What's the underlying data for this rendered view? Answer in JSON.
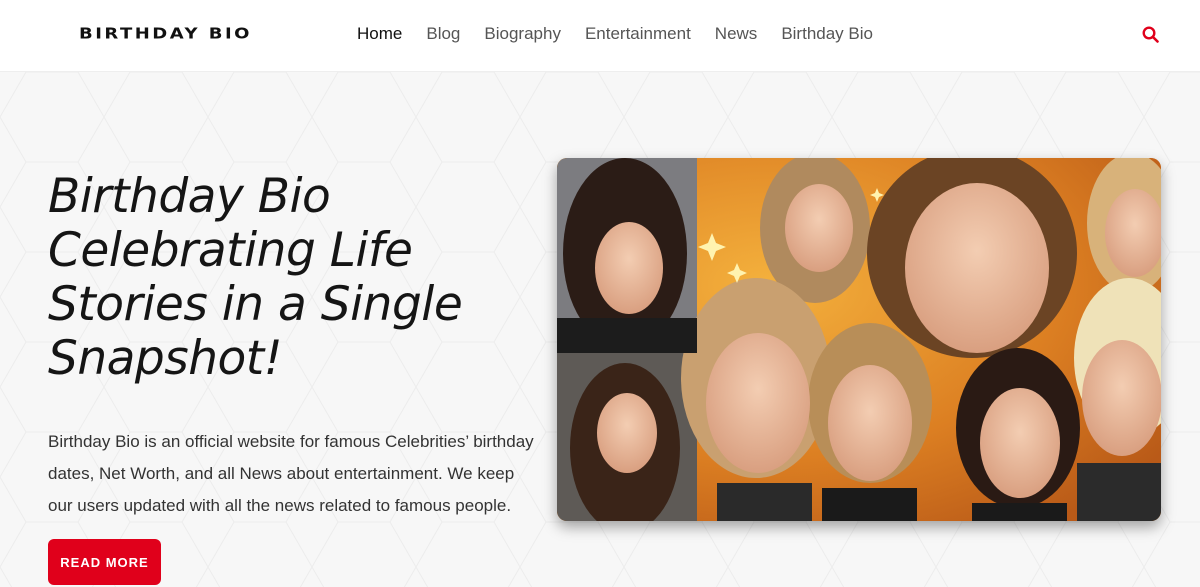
{
  "header": {
    "logo_text": "BIRTHDAY BIO",
    "nav": [
      {
        "label": "Home",
        "active": true
      },
      {
        "label": "Blog",
        "active": false
      },
      {
        "label": "Biography",
        "active": false
      },
      {
        "label": "Entertainment",
        "active": false
      },
      {
        "label": "News",
        "active": false
      },
      {
        "label": "Birthday Bio",
        "active": false
      }
    ],
    "search_icon": "search-icon"
  },
  "hero": {
    "title": "Birthday Bio Celebrating Life Stories in a Single Snapshot!",
    "description": "Birthday Bio is an official website for famous Celebrities’ birthday dates, Net Worth, and all News about entertainment. We keep our users updated with all the news related to famous people.",
    "button_label": "READ MORE",
    "image": "celebrity-collage"
  },
  "colors": {
    "accent": "#e0001b",
    "text_dark": "#151515",
    "background": "#f7f7f7",
    "header_bg": "#ffffff"
  }
}
